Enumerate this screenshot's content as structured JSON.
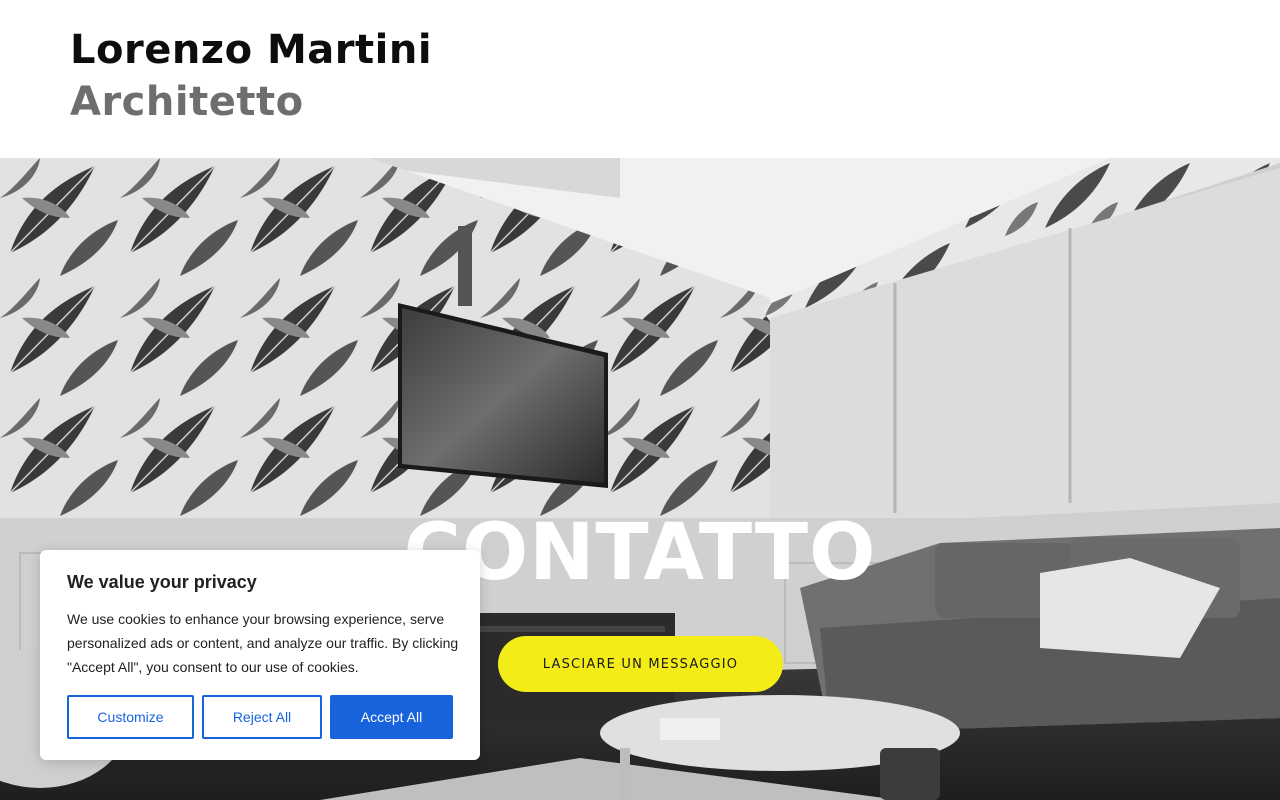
{
  "header": {
    "name": "Lorenzo Martini",
    "role": "Architetto"
  },
  "hero": {
    "title": "CONTATTO",
    "cta_label": "LASCIARE UN MESSAGGIO"
  },
  "cookie_banner": {
    "title": "We value your privacy",
    "body": "We use cookies to enhance your browsing experience, serve personalized ads or content, and analyze our traffic. By clicking \"Accept All\", you consent to our use of cookies.",
    "customize_label": "Customize",
    "reject_label": "Reject All",
    "accept_label": "Accept All"
  },
  "colors": {
    "cta_background": "#f3ec17",
    "cookie_primary": "#1863dc",
    "brand_name": "#0d0d0d",
    "brand_role": "#6e6e6e"
  }
}
